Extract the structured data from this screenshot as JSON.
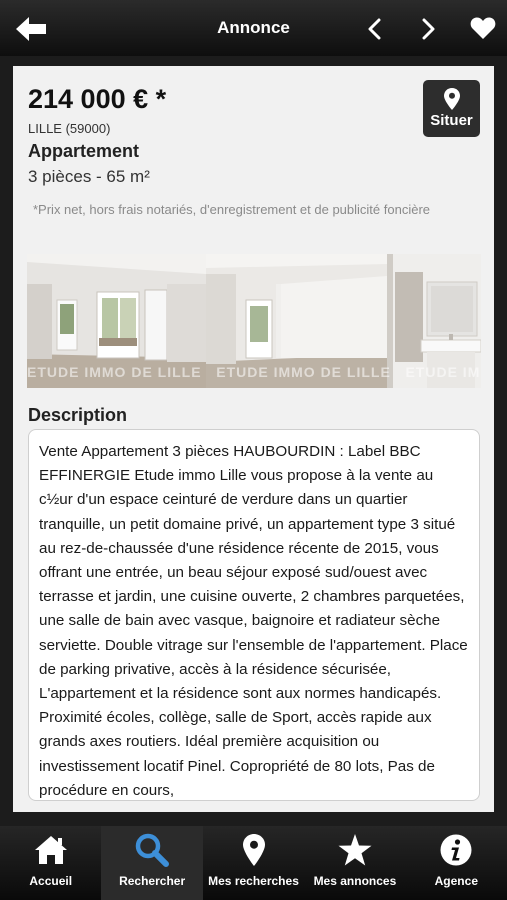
{
  "header": {
    "title": "Annonce",
    "back_icon": "arrow-left-icon",
    "prev_icon": "chevron-left-icon",
    "next_icon": "chevron-right-icon",
    "fav_icon": "heart-icon"
  },
  "listing": {
    "price": "214 000 € *",
    "city": "LILLE (59000)",
    "type": "Appartement",
    "rooms_area": "3 pièces - 65 m²",
    "locate_label": "Situer",
    "price_note": "*Prix net, hors frais notariés, d'enregistrement et de publicité foncière",
    "watermark": "ETUDE IMMO DE LILLE",
    "description_title": "Description",
    "description": "Vente Appartement 3 pièces HAUBOURDIN : Label BBC EFFINERGIE Etude immo Lille vous propose à la vente au c½ur d'un espace ceinturé de verdure dans un quartier tranquille, un petit domaine privé, un appartement type 3 situé au rez-de-chaussée d'une résidence récente de 2015, vous offrant une entrée, un beau séjour exposé sud/ouest avec terrasse et jardin, une cuisine ouverte, 2 chambres parquetées, une salle de bain avec vasque, baignoire et radiateur sèche serviette. Double vitrage sur l'ensemble de l'appartement. Place de parking privative, accès à la résidence sécurisée, L'appartement et la résidence sont aux normes handicapés. Proximité écoles, collège, salle de Sport, accès rapide aux grands axes routiers. Idéal première acquisition ou investissement locatif Pinel. Copropriété de 80 lots, Pas de procédure en cours,"
  },
  "tabs": [
    {
      "label": "Accueil",
      "icon": "home-icon"
    },
    {
      "label": "Rechercher",
      "icon": "search-icon",
      "active": true
    },
    {
      "label": "Mes recherches",
      "icon": "map-pin-icon"
    },
    {
      "label": "Mes annonces",
      "icon": "star-icon"
    },
    {
      "label": "Agence",
      "icon": "info-icon"
    }
  ],
  "colors": {
    "active_tab_icon": "#3d8fd8",
    "card_bg": "#f1f1f1",
    "bar_bg": "#111111"
  }
}
